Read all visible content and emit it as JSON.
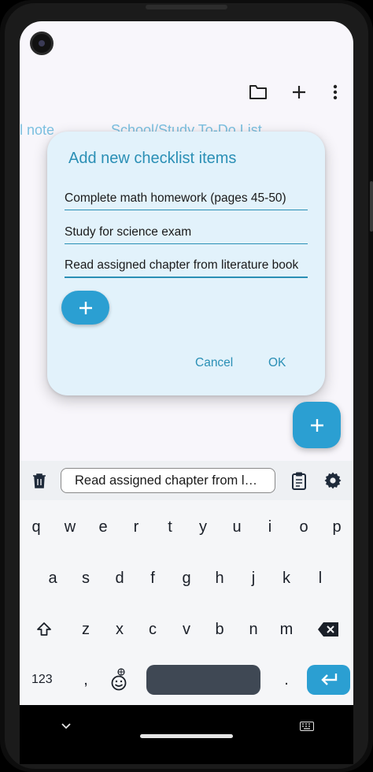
{
  "app": {
    "tabs": [
      {
        "label": "l note"
      },
      {
        "label": "School/Study To-Do List"
      }
    ]
  },
  "dialog": {
    "title": "Add new checklist items",
    "items": [
      {
        "value": "Complete math homework (pages 45-50)"
      },
      {
        "value": "Study for science exam"
      },
      {
        "value": "Read assigned chapter from literature book"
      }
    ],
    "cancel_label": "Cancel",
    "ok_label": "OK"
  },
  "keyboard": {
    "clipboard_suggestion": "Read assigned chapter from l…",
    "row1": [
      "q",
      "w",
      "e",
      "r",
      "t",
      "y",
      "u",
      "i",
      "o",
      "p"
    ],
    "row2": [
      "a",
      "s",
      "d",
      "f",
      "g",
      "h",
      "j",
      "k",
      "l"
    ],
    "row3": [
      "z",
      "x",
      "c",
      "v",
      "b",
      "n",
      "m"
    ],
    "numbers_label": "123",
    "comma_label": ",",
    "period_label": "."
  },
  "colors": {
    "accent": "#2b9fd2",
    "dialog_bg": "#e2f2fb"
  }
}
